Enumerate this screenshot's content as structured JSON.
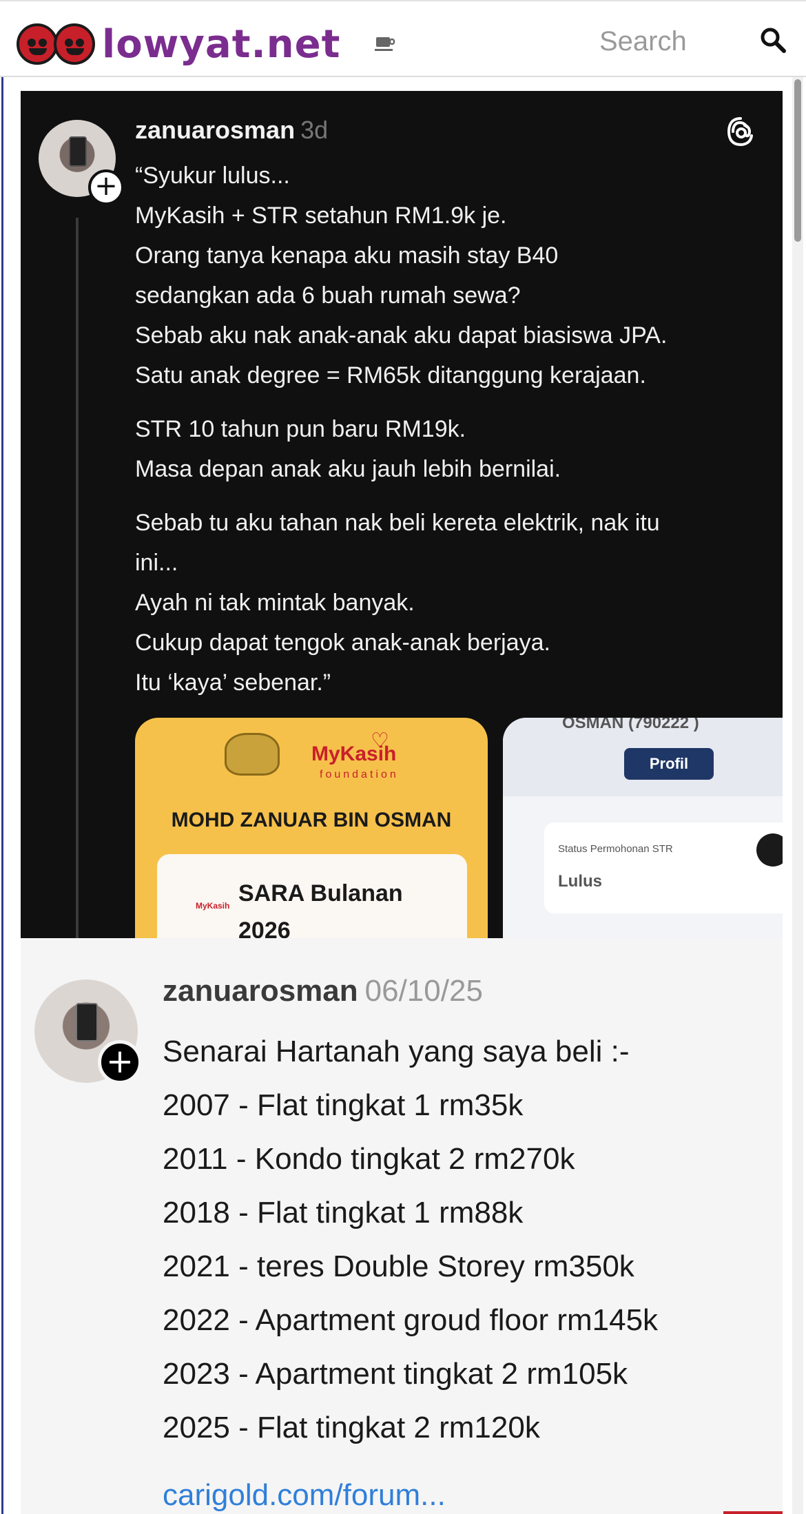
{
  "site": {
    "logo_text": "lowyat.net",
    "brand_color": "#7b2d8f",
    "search_placeholder": "Search"
  },
  "post1": {
    "username": "zanuarosman",
    "timestamp": "3d",
    "lines": [
      "“Syukur lulus...",
      "MyKasih + STR setahun RM1.9k je.",
      "Orang tanya kenapa aku masih stay B40",
      "sedangkan ada 6 buah rumah sewa?",
      "Sebab aku nak anak-anak aku dapat biasiswa JPA.",
      "Satu anak degree = RM65k ditanggung kerajaan.",
      "STR 10 tahun pun baru RM19k.",
      "Masa depan anak aku jauh lebih bernilai.",
      "Sebab tu aku tahan nak beli kereta elektrik, nak itu",
      "ini...",
      "Ayah ni tak mintak banyak.",
      "Cukup dapat tengok anak-anak berjaya.",
      "Itu ‘kaya’ sebenar.”"
    ],
    "mykasih_card": {
      "logo": "MyKasih",
      "logo_sub": "foundation",
      "name": "MOHD ZANUAR BIN OSMAN",
      "inner_logo": "MyKasih",
      "inner_title": "SARA Bulanan 2026"
    },
    "str_card": {
      "name": "OSMAN (790222          )",
      "profil_button": "Profil",
      "status_label": "Status Permohonan STR",
      "status_value": "Lulus"
    }
  },
  "post2": {
    "username": "zanuarosman",
    "timestamp": "06/10/25",
    "lines": [
      "Senarai Hartanah yang saya beli :-",
      "2007 - Flat tingkat 1 rm35k",
      "2011 - Kondo tingkat 2 rm270k",
      "2018 - Flat tingkat 1 rm88k",
      "2021 - teres Double Storey rm350k",
      "2022 - Apartment groud floor rm145k",
      "2023 - Apartment tingkat 2 rm105k",
      "2025 - Flat tingkat 2 rm120k"
    ],
    "link": "carigold.com/forum..."
  }
}
